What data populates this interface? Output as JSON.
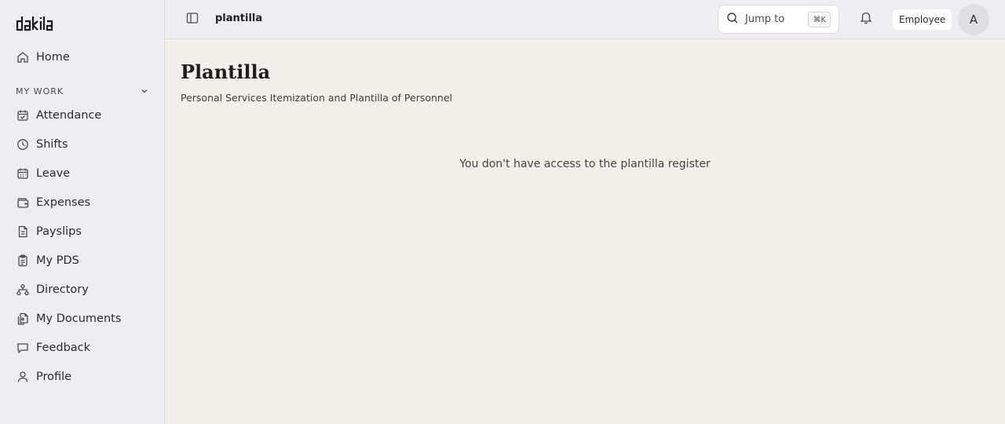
{
  "app": {
    "logo_text": "dakila"
  },
  "sidebar": {
    "home": {
      "label": "Home",
      "icon": "home-icon"
    },
    "section": {
      "label": "MY WORK",
      "icon": "chevron-down-icon"
    },
    "items": [
      {
        "label": "Attendance",
        "icon": "calendar-check-icon"
      },
      {
        "label": "Shifts",
        "icon": "clock-icon"
      },
      {
        "label": "Leave",
        "icon": "calendar-icon"
      },
      {
        "label": "Expenses",
        "icon": "wallet-icon"
      },
      {
        "label": "Payslips",
        "icon": "document-icon"
      },
      {
        "label": "My PDS",
        "icon": "clipboard-icon"
      },
      {
        "label": "Directory",
        "icon": "org-chart-icon"
      },
      {
        "label": "My Documents",
        "icon": "file-stack-icon"
      },
      {
        "label": "Feedback",
        "icon": "message-square-icon"
      },
      {
        "label": "Profile",
        "icon": "user-icon"
      }
    ]
  },
  "topbar": {
    "breadcrumb": "plantilla",
    "search": {
      "label": "Jump to",
      "shortcut": "⌘K"
    },
    "role": "Employee",
    "avatar_initial": "A"
  },
  "page": {
    "title": "Plantilla",
    "subtitle": "Personal Services Itemization and Plantilla of Personnel",
    "empty_message": "You don't have access to the plantilla register"
  },
  "colors": {
    "sidebar_bg": "#eceef1",
    "main_bg": "#f3efe8",
    "text": "#2a2a2a"
  }
}
